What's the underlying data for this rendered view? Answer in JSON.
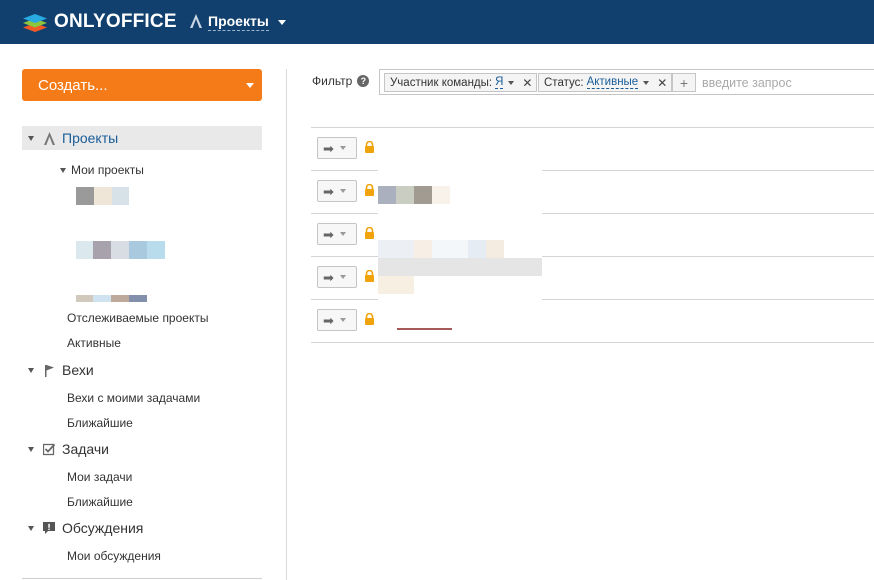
{
  "header": {
    "app_name": "ONLYOFFICE",
    "module_label": "Проекты",
    "bg_color": "#11406e"
  },
  "sidebar": {
    "create_button": "Создать...",
    "projects": "Проекты",
    "my_projects": "Мои проекты",
    "followed_projects": "Отслеживаемые проекты",
    "active": "Активные",
    "milestones": "Вехи",
    "milestones_my_tasks": "Вехи с моими задачами",
    "milestones_upcoming": "Ближайшие",
    "tasks": "Задачи",
    "my_tasks": "Мои задачи",
    "tasks_upcoming": "Ближайшие",
    "discussions": "Обсуждения",
    "my_discussions": "Мои обсуждения"
  },
  "filter": {
    "label": "Фильтр",
    "tags": [
      {
        "name": "Участник команды:",
        "value": "Я"
      },
      {
        "name": "Статус:",
        "value": "Активные"
      }
    ],
    "placeholder": "введите запрос"
  },
  "projects_list": {
    "row_count": 5
  },
  "colors": {
    "accent": "#f47b18",
    "link": "#1a5d99",
    "lock": "#f0a30a"
  }
}
